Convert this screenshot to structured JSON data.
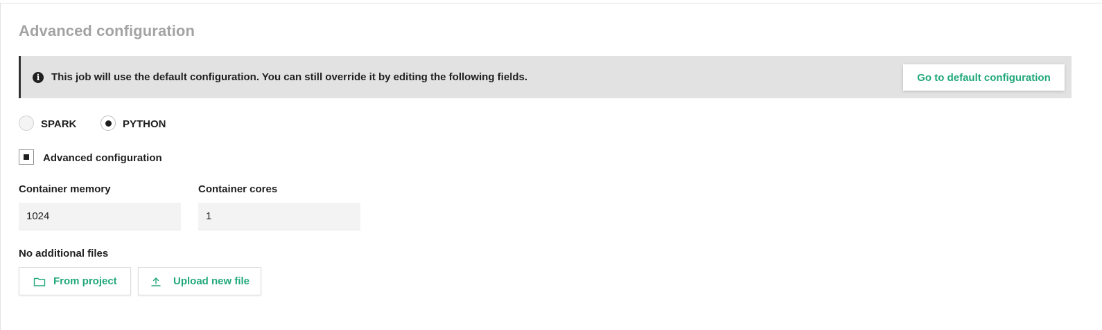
{
  "section": {
    "title": "Advanced configuration"
  },
  "banner": {
    "icon": "info-icon",
    "icon_glyph": "i",
    "message": "This job will use the default configuration. You can still override it by editing the following fields.",
    "button_label": "Go to default configuration"
  },
  "job_type": {
    "options": [
      {
        "label": "SPARK",
        "selected": false
      },
      {
        "label": "PYTHON",
        "selected": true
      }
    ]
  },
  "advanced": {
    "checkbox_label": "Advanced configuration",
    "checked": true
  },
  "fields": {
    "memory_label": "Container memory",
    "memory_value": "1024",
    "cores_label": "Container cores",
    "cores_value": "1"
  },
  "files": {
    "status": "No additional files",
    "from_project_label": "From project",
    "from_project_icon": "folder-icon",
    "upload_label": "Upload new file",
    "upload_icon": "upload-icon"
  },
  "colors": {
    "accent": "#21a87a",
    "banner_bg": "#e2e2e2",
    "title": "#a3a3a3"
  }
}
